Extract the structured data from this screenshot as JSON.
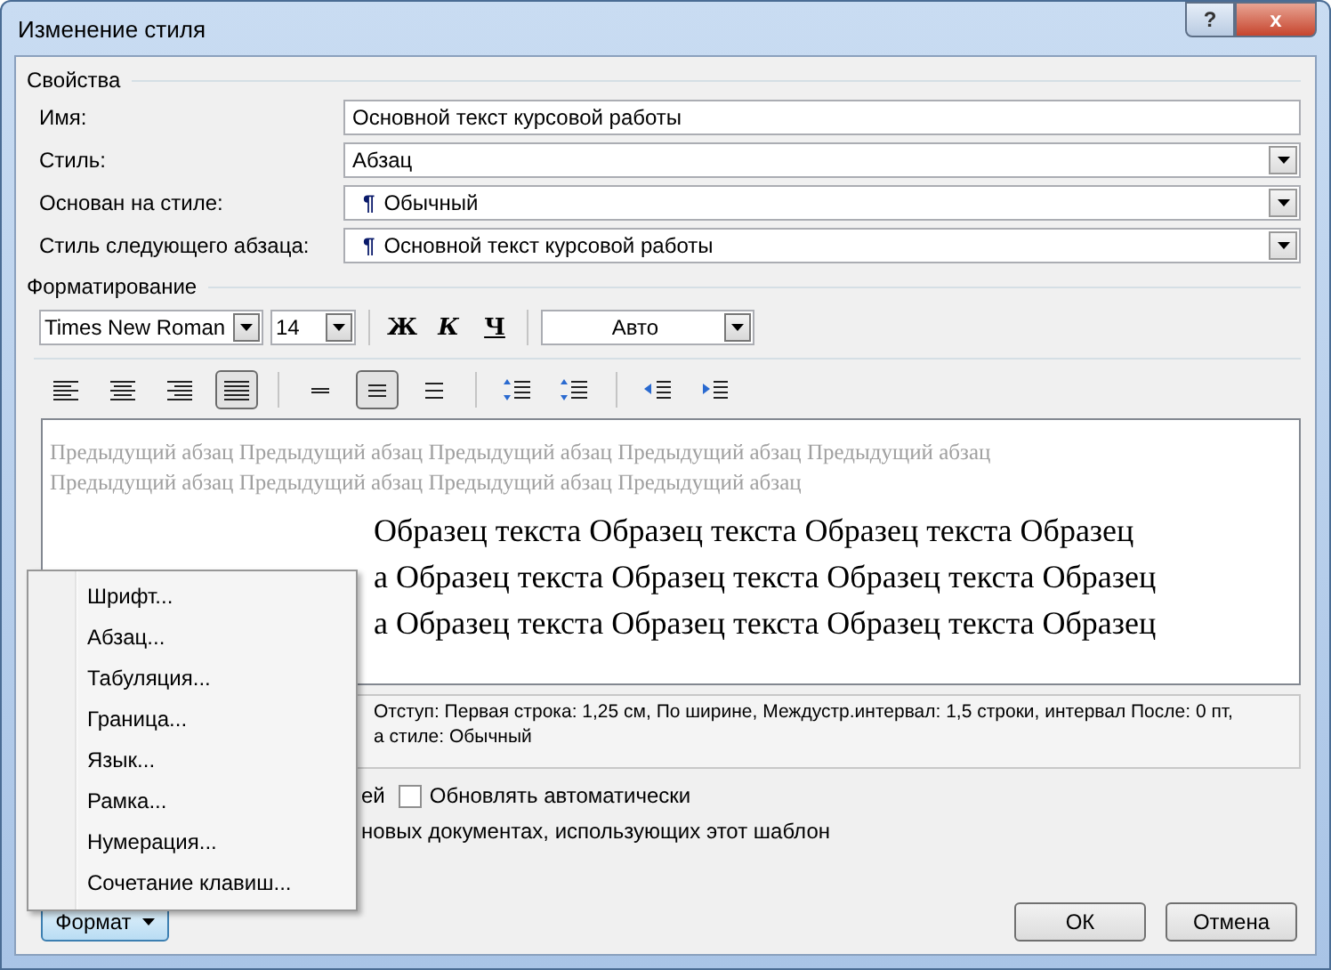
{
  "window": {
    "title": "Изменение стиля",
    "help_button": "?",
    "close_button": "x"
  },
  "properties": {
    "title": "Свойства",
    "fields": [
      {
        "label": "Имя:",
        "value": "Основной текст курсовой работы",
        "kind": "text"
      },
      {
        "label": "Стиль:",
        "value": "Абзац",
        "kind": "combo"
      },
      {
        "label": "Основан на стиле:",
        "value": "Обычный",
        "kind": "combo",
        "pilcrow": "¶"
      },
      {
        "label": "Стиль следующего абзаца:",
        "value": "Основной текст курсовой работы",
        "kind": "combo",
        "pilcrow": "¶"
      }
    ]
  },
  "formatting": {
    "title": "Форматирование",
    "font": "Times New Roman",
    "size": "14",
    "bold": "Ж",
    "italic": "К",
    "underline": "Ч",
    "font_color": "Авто",
    "tools": [
      {
        "kind": "align-left",
        "selected": false
      },
      {
        "kind": "align-center",
        "selected": false
      },
      {
        "kind": "align-right",
        "selected": false
      },
      {
        "kind": "align-justify",
        "selected": true
      },
      {
        "kind": "spacing-single",
        "selected": false
      },
      {
        "kind": "spacing-half",
        "selected": true
      },
      {
        "kind": "spacing-double",
        "selected": false
      },
      {
        "kind": "space-before",
        "selected": false
      },
      {
        "kind": "space-after",
        "selected": false
      },
      {
        "kind": "indent-decrease",
        "selected": false
      },
      {
        "kind": "indent-increase",
        "selected": false
      }
    ]
  },
  "preview": {
    "previous": "Предыдущий абзац Предыдущий абзац Предыдущий абзац Предыдущий абзац Предыдущий абзац Предыдущий абзац Предыдущий абзац Предыдущий абзац Предыдущий абзац",
    "sample_lines": [
      "Образец текста Образец текста Образец текста Образец",
      "а Образец текста Образец текста Образец текста Образец",
      "а Образец текста Образец текста Образец текста Образец"
    ]
  },
  "description": [
    "Отступ: Первая строка:  1,25 см, По ширине, Междустр.интервал:  1,5 строки, интервал После:  0 пт,",
    "а стиле: Обычный"
  ],
  "options": {
    "partial_1": "ей",
    "auto_update": {
      "label": "Обновлять автоматически",
      "checked": false
    },
    "partial_2": "новых документах, использующих этот шаблон"
  },
  "format_menu": {
    "items": [
      "Шрифт...",
      "Абзац...",
      "Табуляция...",
      "Граница...",
      "Язык...",
      "Рамка...",
      "Нумерация...",
      "Сочетание клавиш..."
    ]
  },
  "buttons": {
    "format": "Формат",
    "ok": "ОК",
    "cancel": "Отмена"
  }
}
